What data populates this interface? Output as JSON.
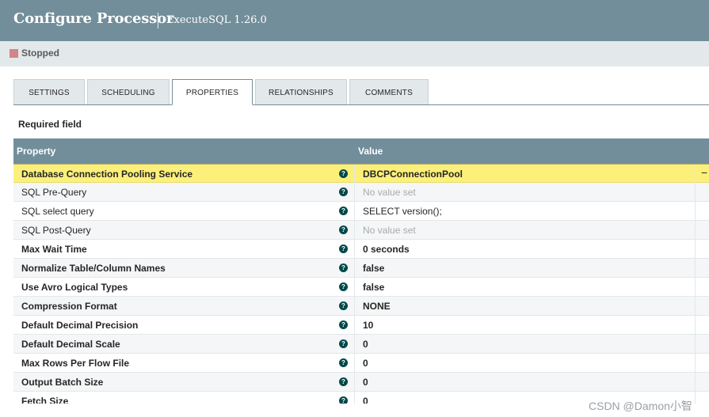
{
  "header": {
    "title": "Configure Processor",
    "subtitle": "ExecuteSQL 1.26.0"
  },
  "status": {
    "label": "Stopped",
    "color": "#d18686"
  },
  "tabs": [
    {
      "label": "SETTINGS"
    },
    {
      "label": "SCHEDULING"
    },
    {
      "label": "PROPERTIES",
      "active": true
    },
    {
      "label": "RELATIONSHIPS"
    },
    {
      "label": "COMMENTS"
    }
  ],
  "required_label": "Required field",
  "table": {
    "headers": {
      "property": "Property",
      "value": "Value"
    },
    "rows": [
      {
        "name": "Database Connection Pooling Service",
        "value": "DBCPConnectionPool",
        "required": true,
        "selected": true,
        "action": "−"
      },
      {
        "name": "SQL Pre-Query",
        "value": "No value set",
        "required": false,
        "empty": true
      },
      {
        "name": "SQL select query",
        "value": "SELECT version();",
        "required": false
      },
      {
        "name": "SQL Post-Query",
        "value": "No value set",
        "required": false,
        "empty": true
      },
      {
        "name": "Max Wait Time",
        "value": "0 seconds",
        "required": true
      },
      {
        "name": "Normalize Table/Column Names",
        "value": "false",
        "required": true
      },
      {
        "name": "Use Avro Logical Types",
        "value": "false",
        "required": true
      },
      {
        "name": "Compression Format",
        "value": "NONE",
        "required": true
      },
      {
        "name": "Default Decimal Precision",
        "value": "10",
        "required": true
      },
      {
        "name": "Default Decimal Scale",
        "value": "0",
        "required": true
      },
      {
        "name": "Max Rows Per Flow File",
        "value": "0",
        "required": true
      },
      {
        "name": "Output Batch Size",
        "value": "0",
        "required": true
      },
      {
        "name": "Fetch Size",
        "value": "0",
        "required": true
      }
    ],
    "help_icon": "help-circle-icon",
    "help_glyph": "?"
  },
  "watermark": "CSDN @Damon小智",
  "colors": {
    "header_bg": "#728e9b",
    "selected_row": "#fcf07a",
    "help_icon": "#004849"
  }
}
